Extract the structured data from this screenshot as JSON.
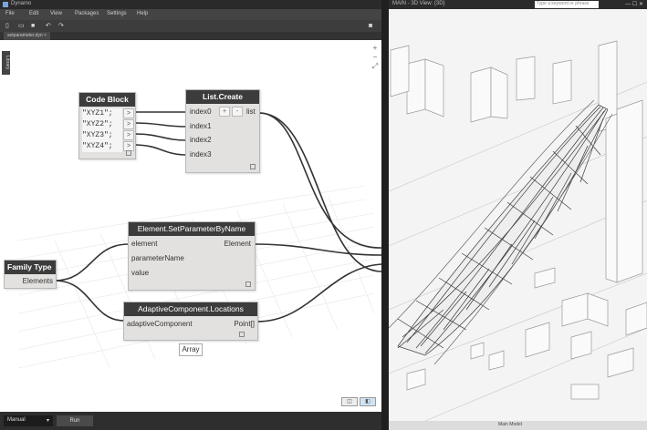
{
  "dynamo": {
    "title": "Dynamo",
    "menu": [
      "File",
      "Edit",
      "View",
      "Packages",
      "Settings",
      "Help"
    ],
    "tab": "setparameter.dyn",
    "library_label": "Library",
    "run_mode": "Manual",
    "run_label": "Run",
    "array_label": "Array",
    "nodes": {
      "code_block": {
        "title": "Code Block",
        "lines": [
          "\"XYZ1\";",
          "\"XYZ2\";",
          "\"XYZ3\";",
          "\"XYZ4\";"
        ],
        "pin": ">"
      },
      "list_create": {
        "title": "List.Create",
        "inputs": [
          "index0",
          "index1",
          "index2",
          "index3"
        ],
        "add": "+",
        "remove": "-",
        "output": "list"
      },
      "set_param": {
        "title": "Element.SetParameterByName",
        "inputs": [
          "element",
          "parameterName",
          "value"
        ],
        "output": "Element"
      },
      "family_type": {
        "title": "Family Type",
        "output": "Elements"
      },
      "adaptive": {
        "title": "AdaptiveComponent.Locations",
        "input": "adaptiveComponent",
        "output": "Point[]"
      }
    }
  },
  "revit": {
    "title": "MAIN - 3D View: {3D}",
    "search_placeholder": "Type a keyword or phrase",
    "status_model": "Main Model",
    "window_controls": "—  ☐  ✕"
  },
  "colors": {
    "node_header": "#3c3c3c",
    "node_body": "#e3e1df",
    "wire": "#333333",
    "canvas": "#ffffff",
    "chrome_dark": "#2e2e2e"
  }
}
